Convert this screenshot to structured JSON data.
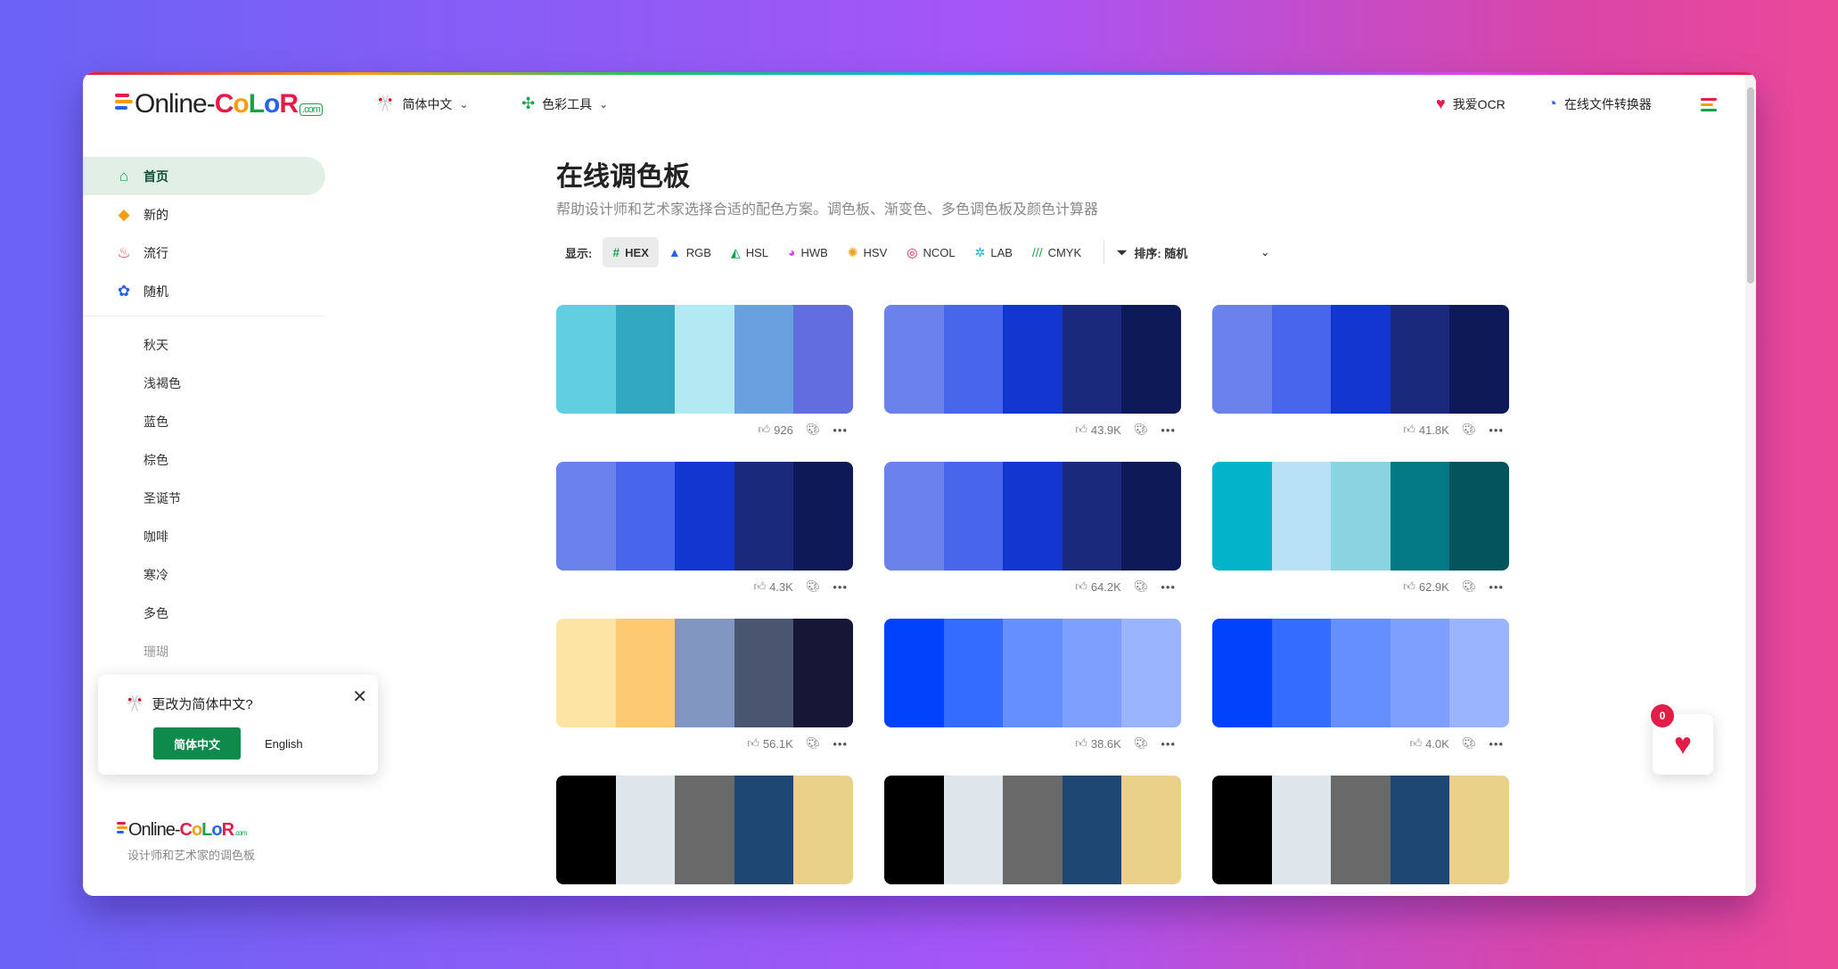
{
  "header": {
    "logo": {
      "online": "Online-",
      "c1": "C",
      "c2": "o",
      "c3": "L",
      "c4": "o",
      "c5": "R",
      "com": ".com"
    },
    "lang_label": "简体中文",
    "tools_label": "色彩工具",
    "ocr_label": "我爱OCR",
    "converter_label": "在线文件转换器"
  },
  "sidebar": {
    "main_items": [
      {
        "label": "首页",
        "icon": "home-icon"
      },
      {
        "label": "新的",
        "icon": "cube-icon"
      },
      {
        "label": "流行",
        "icon": "fire-icon"
      },
      {
        "label": "随机",
        "icon": "shuffle-icon"
      }
    ],
    "sub_items": [
      "秋天",
      "浅褐色",
      "蓝色",
      "棕色",
      "圣诞节",
      "咖啡",
      "寒冷",
      "多色",
      "珊瑚"
    ]
  },
  "lang_popup": {
    "question": "更改为简体中文?",
    "btn_cn": "简体中文",
    "btn_en": "English"
  },
  "footer": {
    "tagline": "设计师和艺术家的调色板"
  },
  "main": {
    "title": "在线调色板",
    "subtitle": "帮助设计师和艺术家选择合适的配色方案。调色板、渐变色、多色调色板及颜色计算器",
    "show_label": "显示:",
    "formats": [
      "HEX",
      "RGB",
      "HSL",
      "HWB",
      "HSV",
      "NCOL",
      "LAB",
      "CMYK"
    ],
    "active_format": "HEX",
    "sort_label": "排序: 随机"
  },
  "palettes": [
    {
      "colors": [
        "#62cfe0",
        "#32a9c0",
        "#b2e9f3",
        "#69a0e0",
        "#626ee0"
      ],
      "likes": "926"
    },
    {
      "colors": [
        "#6b82ed",
        "#4866eb",
        "#1436d0",
        "#1a297c",
        "#0d1a57"
      ],
      "likes": "43.9K"
    },
    {
      "colors": [
        "#6b82ed",
        "#4866eb",
        "#1436d0",
        "#1a297c",
        "#0d1a57"
      ],
      "likes": "41.8K"
    },
    {
      "colors": [
        "#6b82ed",
        "#4866eb",
        "#1436d0",
        "#1a297c",
        "#0d1a57"
      ],
      "likes": "4.3K"
    },
    {
      "colors": [
        "#6b82ed",
        "#4866eb",
        "#1436d0",
        "#1a297c",
        "#0d1a57"
      ],
      "likes": "64.2K"
    },
    {
      "colors": [
        "#03b3ca",
        "#b8e1f6",
        "#8ad3e0",
        "#037985",
        "#03545d"
      ],
      "likes": "62.9K"
    },
    {
      "colors": [
        "#fbe4a4",
        "#fdca71",
        "#8296c2",
        "#4a566f",
        "#161737"
      ],
      "likes": "56.1K"
    },
    {
      "colors": [
        "#0142fd",
        "#346dfd",
        "#658ffd",
        "#7e9ffd",
        "#9ab4fe"
      ],
      "likes": "38.6K"
    },
    {
      "colors": [
        "#0142fd",
        "#346dfd",
        "#658ffd",
        "#7e9ffd",
        "#9ab4fe"
      ],
      "likes": "4.0K"
    },
    {
      "colors": [
        "#000000",
        "#dee6eb",
        "#696969",
        "#1e4873",
        "#e9d18a"
      ],
      "likes": ""
    },
    {
      "colors": [
        "#000000",
        "#dee6eb",
        "#696969",
        "#1e4873",
        "#e9d18a"
      ],
      "likes": ""
    },
    {
      "colors": [
        "#000000",
        "#dee6eb",
        "#696969",
        "#1e4873",
        "#e9d18a"
      ],
      "likes": ""
    }
  ],
  "fab": {
    "badge": "0"
  },
  "colors": {
    "accent_green": "#0d8a4c",
    "active_bg": "#e1efe7",
    "brand_red": "#e11d48"
  }
}
